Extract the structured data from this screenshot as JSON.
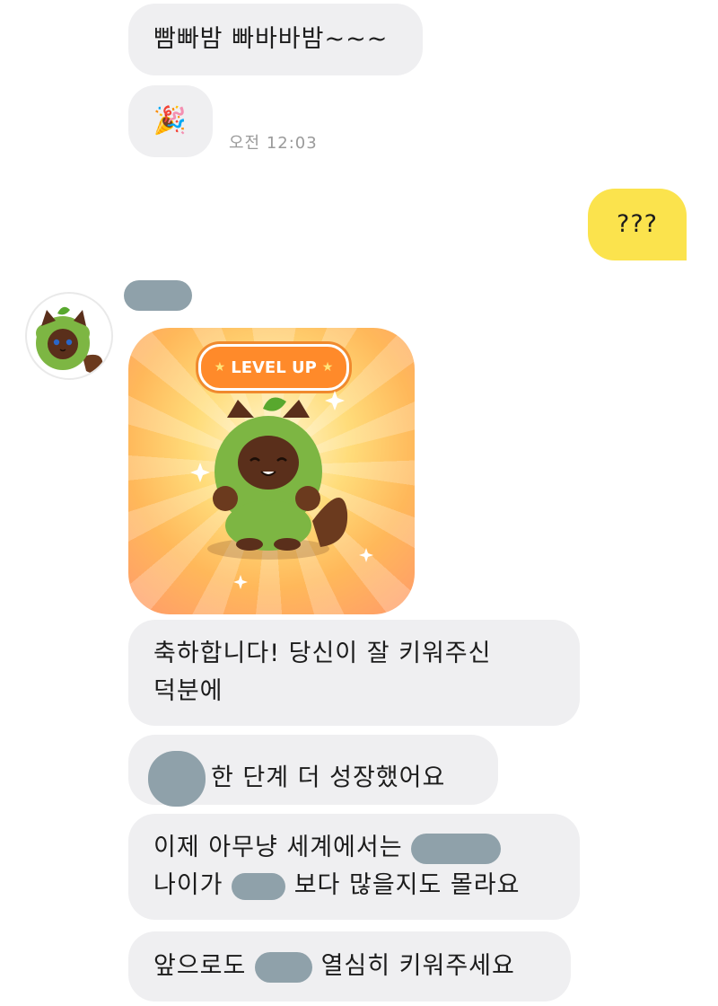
{
  "messages": [
    {
      "text": "빰빠밤 빠바바밤~~~"
    },
    {
      "emoji": "🎉",
      "time": "오전 12:03"
    },
    {
      "text": "???",
      "mine": true
    },
    {
      "text_line1": "축하합니다! 당신이 잘 키워주신",
      "text_line2": "덕분에"
    },
    {
      "text": "한 단계 더 성장했어요"
    },
    {
      "text_line1_prefix": "이제 아무냥 세계에서는",
      "text_line2_prefix": "나이가",
      "text_line2_suffix": "보다 많을지도 몰라요"
    },
    {
      "text_prefix": "앞으로도",
      "text_suffix": "열심히 키워주세요"
    }
  ],
  "card": {
    "badge": "LEVEL UP",
    "star": "★"
  },
  "icons": {
    "avatar": "cat-in-green-leaf-costume-avatar",
    "party": "party-popper-icon",
    "character": "cat-in-green-leaf-costume-illustration"
  },
  "colors": {
    "bubble": "#efeff1",
    "my_bubble": "#fbe34d",
    "blurred": "#8fa1aa",
    "time": "#9a9a9a"
  }
}
